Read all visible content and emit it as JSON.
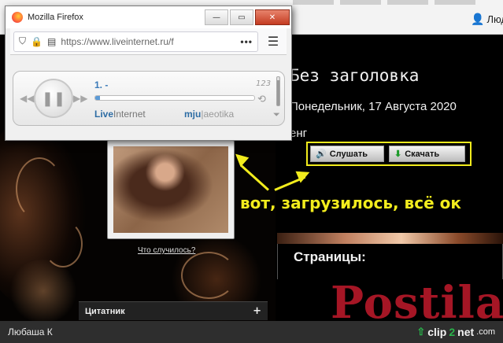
{
  "popup": {
    "window_title": "Mozilla Firefox",
    "url": "https://www.liveinternet.ru/f",
    "controls": {
      "minimize": "—",
      "maximize": "▭",
      "close": "✕"
    },
    "url_more": "•••",
    "menu_icon": "☰",
    "player": {
      "track": "1. -",
      "brand_bold": "Live",
      "brand_rest": "Internet",
      "mju": "mju",
      "separator": "|",
      "tag": "aeotika",
      "order_label": "123",
      "progress_fraction": 0.03,
      "volume_fraction": 0.9,
      "prev": "◀◀",
      "next": "▶▶",
      "pause": "❚❚"
    }
  },
  "page": {
    "user_name": "Люди",
    "post_title": "Без заголовка",
    "post_date": "Понедельник, 17 Августа 2020",
    "post_sub": "енг",
    "listen_label": "Слушать",
    "download_label": "Скачать",
    "photo_caption": "Что случилось?",
    "pages_title": "Страницы:",
    "quote_label": "Цитатник",
    "quote_plus": "+",
    "watermark": "Postila.ru"
  },
  "annotation": {
    "text": "вот, загрузилось, всё ок",
    "color": "#f2ec1d"
  },
  "statusbar": {
    "user": "Любаша К",
    "brand_a": "clip",
    "brand_b": "2",
    "brand_c": "net",
    "brand_d": ".com"
  }
}
